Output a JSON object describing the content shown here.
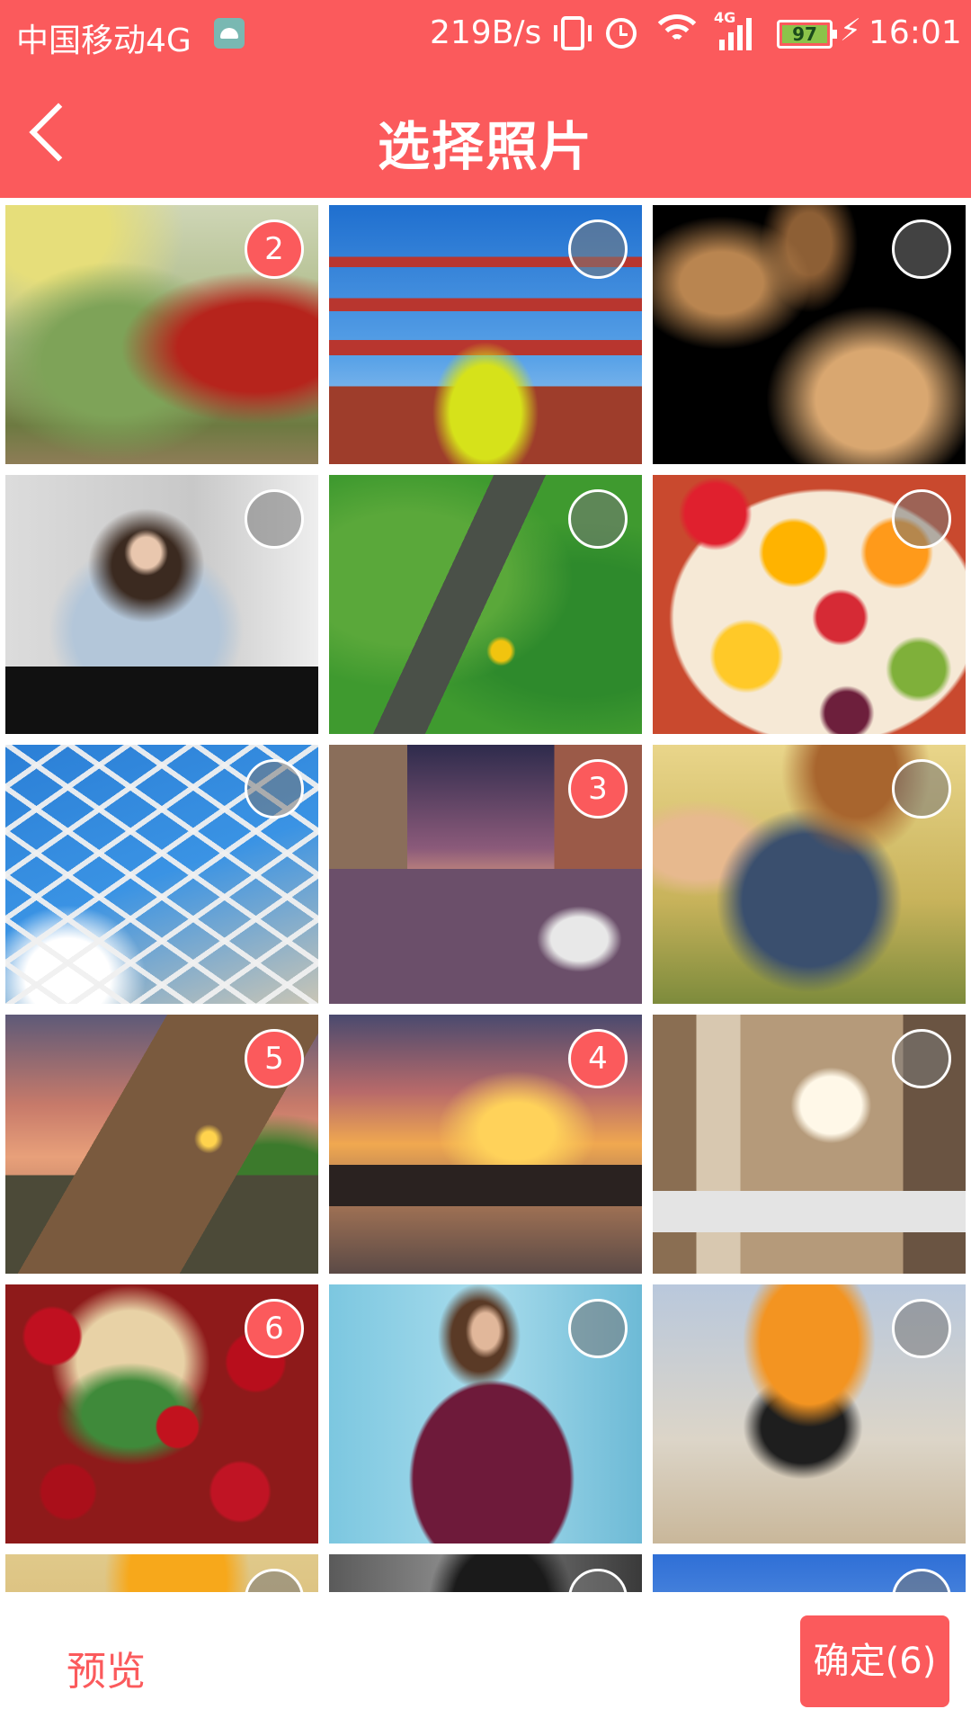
{
  "status_bar": {
    "carrier": "中国移动4G",
    "speed": "219B/s",
    "network_label": "4G",
    "battery": "97",
    "time": "16:01",
    "icons": [
      "android-icon",
      "vibrate-icon",
      "alarm-icon",
      "wifi-icon",
      "signal-icon",
      "battery-icon",
      "charging-icon"
    ]
  },
  "header": {
    "title": "选择照片",
    "back_icon": "chevron-left-icon"
  },
  "grid": {
    "photos": [
      {
        "subject": "park-autumn",
        "selection": "2",
        "selected": true
      },
      {
        "subject": "pagoda",
        "selection": "",
        "selected": false
      },
      {
        "subject": "abstract-curves",
        "selection": "",
        "selected": false
      },
      {
        "subject": "woman-denim-shirt",
        "selection": "",
        "selected": false
      },
      {
        "subject": "road-forest",
        "selection": "",
        "selected": false
      },
      {
        "subject": "fruit-bowl",
        "selection": "",
        "selected": false
      },
      {
        "subject": "glass-dome",
        "selection": "",
        "selected": false
      },
      {
        "subject": "venice-canal",
        "selection": "3",
        "selected": true
      },
      {
        "subject": "woman-bicycle",
        "selection": "",
        "selected": false
      },
      {
        "subject": "cliff-sunset",
        "selection": "5",
        "selected": true
      },
      {
        "subject": "boat-sunset",
        "selection": "4",
        "selected": true
      },
      {
        "subject": "bedroom-lamp",
        "selection": "",
        "selected": false
      },
      {
        "subject": "red-berries",
        "selection": "6",
        "selected": true
      },
      {
        "subject": "woman-purple-dress",
        "selection": "",
        "selected": false
      },
      {
        "subject": "cyclist",
        "selection": "",
        "selected": false
      },
      {
        "subject": "citrus",
        "selection": "",
        "selected": false
      },
      {
        "subject": "dark-object",
        "selection": "",
        "selected": false
      },
      {
        "subject": "blue-sky",
        "selection": "",
        "selected": false
      }
    ]
  },
  "footer": {
    "preview_label": "预览",
    "confirm_label": "确定(6)"
  },
  "colors": {
    "accent": "#fb5a5c",
    "white": "#ffffff"
  }
}
